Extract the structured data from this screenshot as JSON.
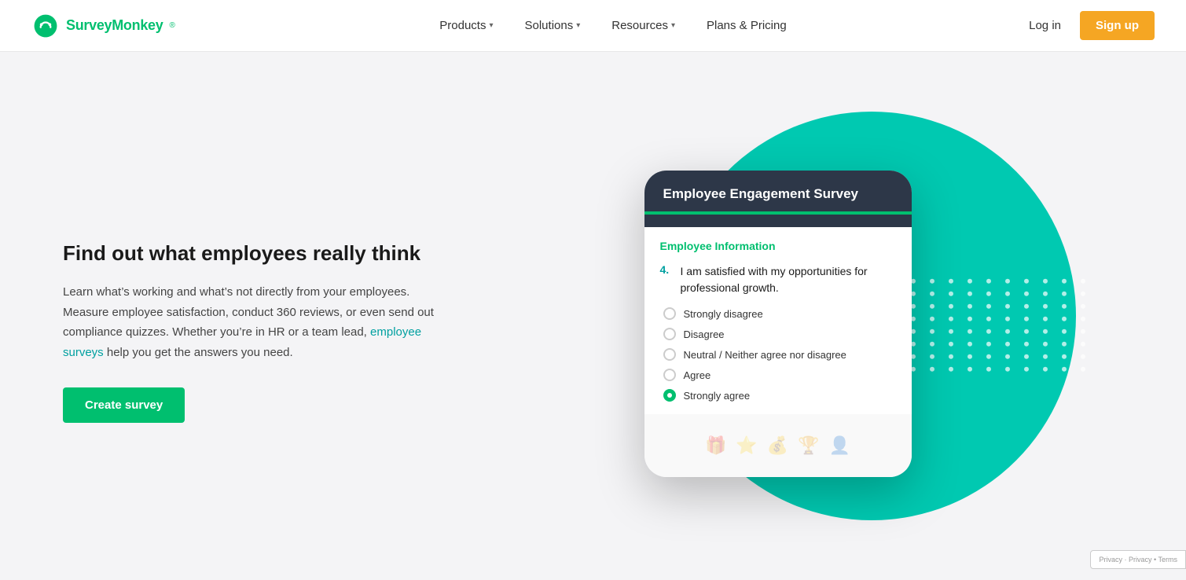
{
  "nav": {
    "logo_text": "SurveyMonkey",
    "logo_tm": "®",
    "items": [
      {
        "label": "Products",
        "has_dropdown": true
      },
      {
        "label": "Solutions",
        "has_dropdown": true
      },
      {
        "label": "Resources",
        "has_dropdown": true
      },
      {
        "label": "Plans & Pricing",
        "has_dropdown": false
      }
    ],
    "login_label": "Log in",
    "signup_label": "Sign up"
  },
  "hero": {
    "title": "Find out what employees really think",
    "description_1": "Learn what’s working and what’s not directly from your employees. Measure employee satisfaction, conduct 360 reviews, or even send out compliance quizzes. Whether you’re in HR or a team lead, ",
    "link_text": "employee surveys",
    "description_2": " help you get the answers you need.",
    "cta_label": "Create survey"
  },
  "phone": {
    "survey_title": "Employee Engagement Survey",
    "section_label": "Employee Information",
    "question_num": "4.",
    "question_text": "I am satisfied with my opportunities for professional growth.",
    "options": [
      {
        "label": "Strongly disagree",
        "selected": false
      },
      {
        "label": "Disagree",
        "selected": false
      },
      {
        "label": "Neutral / Neither agree nor disagree",
        "selected": false
      },
      {
        "label": "Agree",
        "selected": false
      },
      {
        "label": "Strongly agree",
        "selected": true
      }
    ]
  },
  "recaptcha": {
    "text": "Privacy • Terms"
  },
  "colors": {
    "teal": "#00c9b1",
    "green": "#00bf6f",
    "navy": "#2d3748",
    "orange": "#f5a623"
  },
  "dot_count": 80
}
